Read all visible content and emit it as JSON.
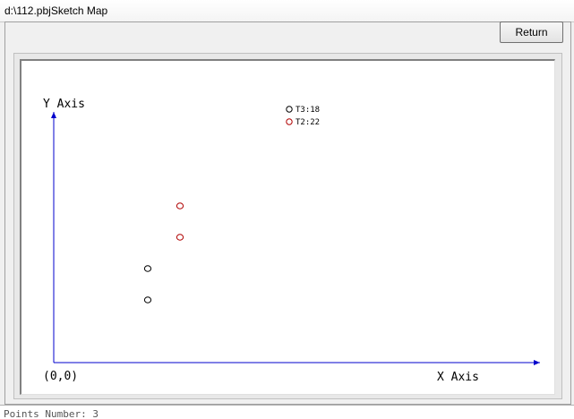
{
  "window": {
    "title": "d:\\112.pbjSketch Map"
  },
  "toolbar": {
    "return_label": "Return"
  },
  "background_strip": {
    "text": "Points Number: 3"
  },
  "chart_data": {
    "type": "scatter",
    "title": "",
    "xlabel": "X Axis",
    "ylabel": "Y Axis",
    "origin_label": "(0,0)",
    "axis_color": "#0000cc",
    "legend_placement": "top-center",
    "grid": false,
    "series": [
      {
        "name": "T3:18",
        "color": "#000000",
        "points": [
          {
            "x": 105,
            "y": 70
          },
          {
            "x": 105,
            "y": 105
          }
        ]
      },
      {
        "name": "T2:22",
        "color": "#b00000",
        "points": [
          {
            "x": 141,
            "y": 140
          },
          {
            "x": 141,
            "y": 175
          }
        ]
      }
    ]
  }
}
